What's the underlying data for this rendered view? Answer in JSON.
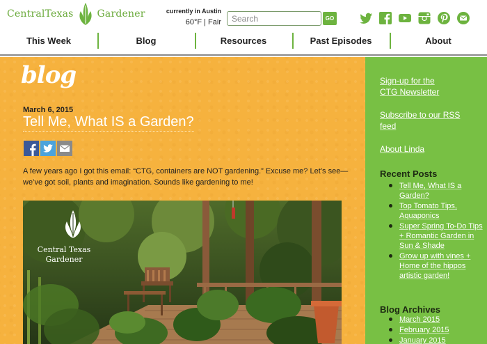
{
  "header": {
    "logo": {
      "text_left": "CentralTexas",
      "text_right": "Gardener"
    },
    "weather": {
      "title": "currently in Austin",
      "value": "60°F | Fair"
    },
    "search": {
      "placeholder": "Search",
      "button_label": "GO"
    },
    "social_icons": [
      "twitter-icon",
      "facebook-icon",
      "youtube-icon",
      "instagram-icon",
      "pinterest-icon",
      "email-icon"
    ]
  },
  "nav": {
    "items": [
      "This Week",
      "Blog",
      "Resources",
      "Past Episodes",
      "About"
    ]
  },
  "main": {
    "section_title": "blog",
    "post": {
      "date": "March 6, 2015",
      "title": "Tell Me, What IS a Garden?",
      "share_icons": [
        "facebook-share-icon",
        "twitter-share-icon",
        "email-share-icon"
      ],
      "excerpt": "A few years ago I got this email: “CTG, containers are NOT gardening.” Excuse me? Let’s see—we’ve got soil, plants and imagination. Sounds like gardening to me!",
      "image_brand": {
        "line1": "Central Texas",
        "line2": "Gardener"
      }
    }
  },
  "sidebar": {
    "newsletter_link": "Sign-up for the CTG Newsletter",
    "rss_link": "Subscribe to our RSS feed",
    "about_link": "About Linda",
    "recent_heading": "Recent Posts",
    "recent_posts": [
      "Tell Me, What IS a Garden?",
      "Top Tomato Tips, Aquaponics",
      "Super Spring To-Do Tips + Romantic Garden in Sun & Shade",
      "Grow up with vines + Home of the hippos artistic garden!"
    ],
    "archives_heading": "Blog Archives",
    "archives": [
      "March 2015",
      "February 2015",
      "January 2015"
    ]
  },
  "colors": {
    "brand_green": "#6db33f",
    "sidebar_green": "#78c044",
    "main_orange": "#f6b23e",
    "twitter": "#4ca3dc",
    "facebook": "#3b5998"
  }
}
